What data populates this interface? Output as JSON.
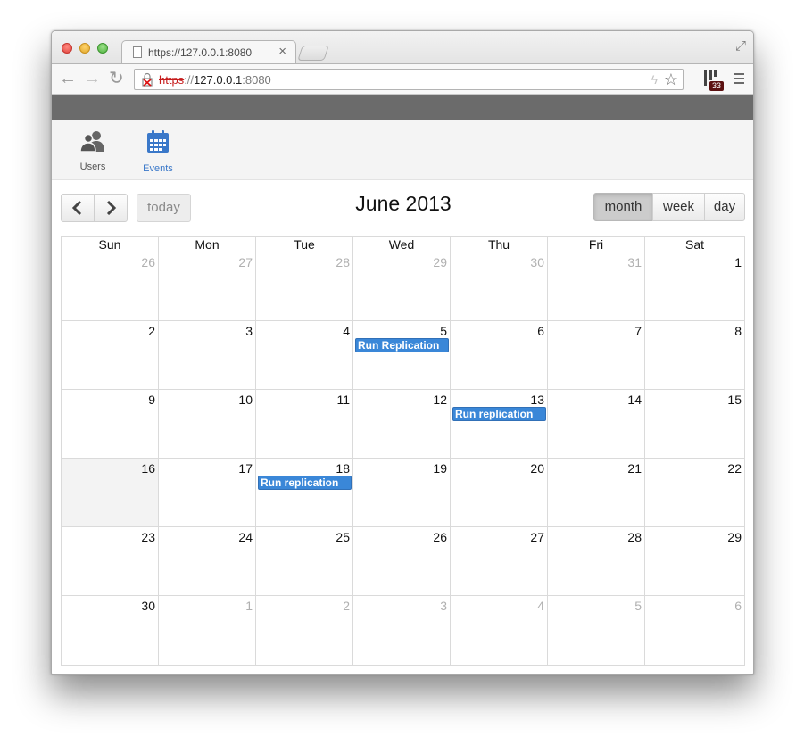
{
  "browser": {
    "tab_title": "https://127.0.0.1:8080",
    "url": {
      "scheme": "https",
      "separator": "://",
      "host": "127.0.0.1",
      "port": ":8080"
    },
    "extension_badge": "33"
  },
  "app_nav": {
    "items": [
      {
        "label": "Users",
        "icon": "users-icon",
        "active": false
      },
      {
        "label": "Events",
        "icon": "calendar-icon",
        "active": true
      }
    ]
  },
  "calendar": {
    "title": "June 2013",
    "today_label": "today",
    "views": [
      "month",
      "week",
      "day"
    ],
    "active_view": "month",
    "prev_icon": "chevron-left-icon",
    "next_icon": "chevron-right-icon",
    "days_of_week": [
      "Sun",
      "Mon",
      "Tue",
      "Wed",
      "Thu",
      "Fri",
      "Sat"
    ],
    "weeks": [
      [
        {
          "day": "26",
          "other": true
        },
        {
          "day": "27",
          "other": true
        },
        {
          "day": "28",
          "other": true
        },
        {
          "day": "29",
          "other": true
        },
        {
          "day": "30",
          "other": true
        },
        {
          "day": "31",
          "other": true
        },
        {
          "day": "1"
        }
      ],
      [
        {
          "day": "2"
        },
        {
          "day": "3"
        },
        {
          "day": "4"
        },
        {
          "day": "5",
          "event": "Run Replication"
        },
        {
          "day": "6"
        },
        {
          "day": "7"
        },
        {
          "day": "8"
        }
      ],
      [
        {
          "day": "9"
        },
        {
          "day": "10"
        },
        {
          "day": "11"
        },
        {
          "day": "12"
        },
        {
          "day": "13",
          "event": "Run replication"
        },
        {
          "day": "14"
        },
        {
          "day": "15"
        }
      ],
      [
        {
          "day": "16",
          "today": true
        },
        {
          "day": "17"
        },
        {
          "day": "18",
          "event": "Run replication"
        },
        {
          "day": "19"
        },
        {
          "day": "20"
        },
        {
          "day": "21"
        },
        {
          "day": "22"
        }
      ],
      [
        {
          "day": "23"
        },
        {
          "day": "24"
        },
        {
          "day": "25"
        },
        {
          "day": "26"
        },
        {
          "day": "27"
        },
        {
          "day": "28"
        },
        {
          "day": "29"
        }
      ],
      [
        {
          "day": "30"
        },
        {
          "day": "1",
          "other": true
        },
        {
          "day": "2",
          "other": true
        },
        {
          "day": "3",
          "other": true
        },
        {
          "day": "4",
          "other": true
        },
        {
          "day": "5",
          "other": true
        },
        {
          "day": "6",
          "other": true
        }
      ]
    ]
  },
  "colors": {
    "accent": "#3a78c9",
    "event_bg": "#3a87d8",
    "top_band": "#6b6b6b",
    "today_bg": "#f3f3f3"
  }
}
